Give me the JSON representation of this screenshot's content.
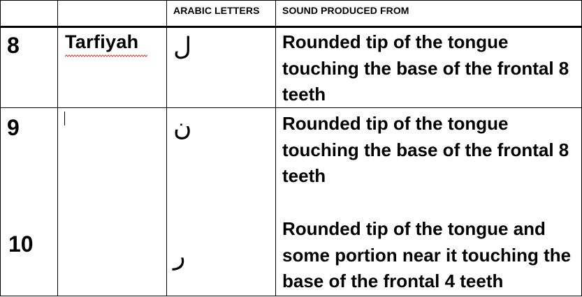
{
  "table": {
    "headers": [
      "",
      "",
      "ARABIC LETTERS",
      "SOUND PRODUCED FROM"
    ],
    "rows": [
      {
        "number": "8",
        "name": "Tarfiyah",
        "letter": "ل",
        "description": "Rounded tip of the tongue touching the base of the frontal 8 teeth"
      },
      {
        "number": "9",
        "name": "",
        "letter": "ن",
        "description": "Rounded tip of the tongue touching the base of the frontal 8 teeth"
      },
      {
        "number": "10",
        "name": "",
        "letter": "ر",
        "description": "Rounded tip of the tongue and some portion near it touching the base of the frontal 4 teeth"
      }
    ]
  },
  "colors": {
    "text": "#000000",
    "border": "#000000",
    "spellcheck": "#d9362b",
    "background": "#ffffff"
  }
}
